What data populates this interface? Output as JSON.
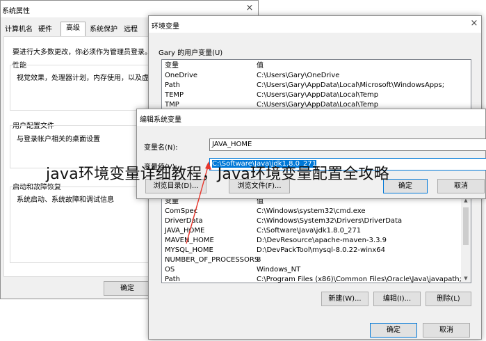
{
  "sys_props": {
    "title": "系统属性",
    "close": "×",
    "tabs": [
      "计算机名",
      "硬件",
      "高级",
      "系统保护",
      "远程"
    ],
    "admin_note": "要进行大多数更改，你必须作为管理员登录。",
    "performance": {
      "header": "性能",
      "desc": "视觉效果，处理器计划，内存使用，以及虚拟"
    },
    "profile": {
      "header": "用户配置文件",
      "desc": "与登录帐户相关的桌面设置"
    },
    "startup": {
      "header": "启动和故障恢复",
      "desc": "系统启动、系统故障和调试信息"
    },
    "ok": "确定"
  },
  "env_vars": {
    "title": "环境变量",
    "close": "×",
    "user_section": "Gary 的用户变量(U)",
    "col_var": "变量",
    "col_val": "值",
    "user_rows": [
      {
        "name": "OneDrive",
        "value": "C:\\Users\\Gary\\OneDrive"
      },
      {
        "name": "Path",
        "value": "C:\\Users\\Gary\\AppData\\Local\\Microsoft\\WindowsApps;"
      },
      {
        "name": "TEMP",
        "value": "C:\\Users\\Gary\\AppData\\Local\\Temp"
      },
      {
        "name": "TMP",
        "value": "C:\\Users\\Gary\\AppData\\Local\\Temp"
      }
    ],
    "sys_rows": [
      {
        "name": "ComSpec",
        "value": "C:\\Windows\\system32\\cmd.exe"
      },
      {
        "name": "DriverData",
        "value": "C:\\Windows\\System32\\Drivers\\DriverData"
      },
      {
        "name": "JAVA_HOME",
        "value": "C:\\Software\\Java\\jdk1.8.0_271"
      },
      {
        "name": "MAVEN_HOME",
        "value": "D:\\DevResource\\apache-maven-3.3.9"
      },
      {
        "name": "MYSQL_HOME",
        "value": "D:\\DevPackTool\\mysql-8.0.22-winx64"
      },
      {
        "name": "NUMBER_OF_PROCESSORS",
        "value": "8"
      },
      {
        "name": "OS",
        "value": "Windows_NT"
      },
      {
        "name": "Path",
        "value": "C:\\Program Files (x86)\\Common Files\\Oracle\\Java\\javapath;C:\\..."
      }
    ],
    "new_btn": "新建(W)...",
    "edit_btn": "编辑(I)...",
    "delete_btn": "删除(L)",
    "ok": "确定",
    "cancel": "取消"
  },
  "edit_dialog": {
    "title": "编辑系统变量",
    "name_label": "变量名(N):",
    "name_value": "JAVA_HOME",
    "value_label": "变量值(V):",
    "value_value": "C:\\Software\\Java\\jdk1.8.0_271",
    "browse_dir": "浏览目录(D)...",
    "browse_file": "浏览文件(F)...",
    "ok": "确定",
    "cancel": "取消"
  },
  "overlay_title": "java环境变量详细教程，Java环境变量配置全攻略",
  "colors": {
    "selection": "#0078d7",
    "arrow": "#e8352b"
  }
}
